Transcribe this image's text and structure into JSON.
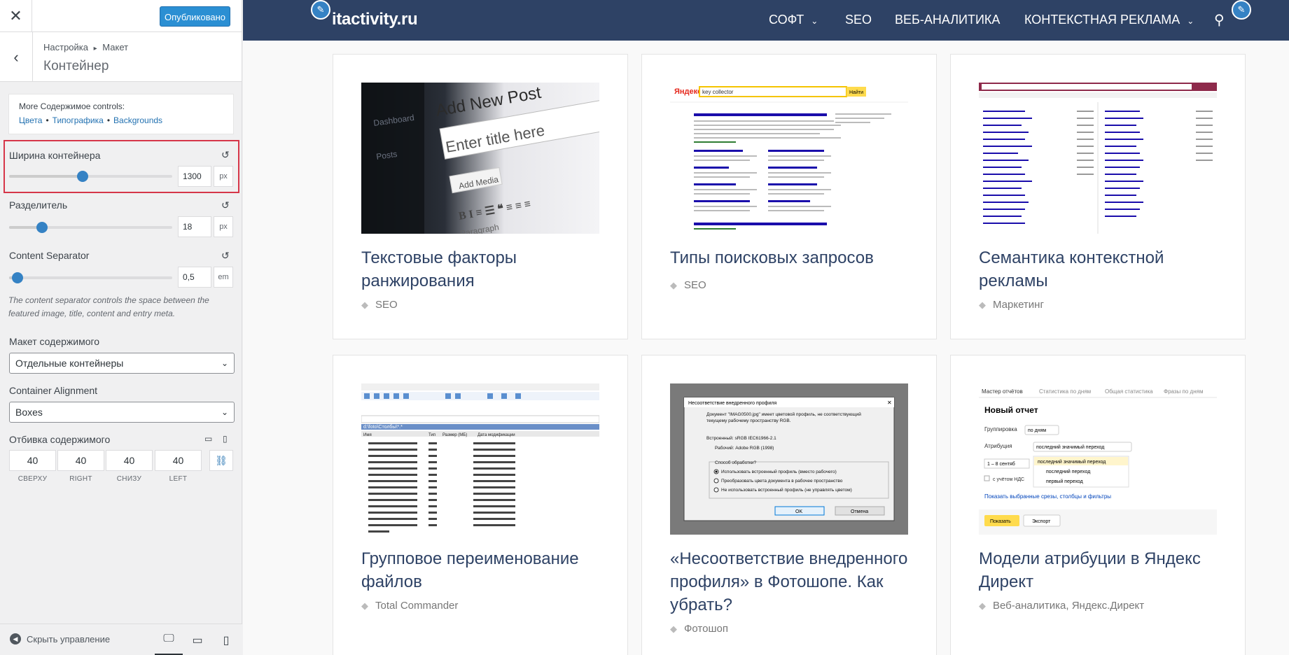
{
  "customizer": {
    "close_icon": "close-icon",
    "publish_label": "Опубликовано",
    "breadcrumb": [
      "Настройка",
      "Макет"
    ],
    "breadcrumb_sep": "▸",
    "section_title": "Контейнер",
    "more_controls": {
      "title": "More Содержимое controls:",
      "links": [
        "Цвета",
        "Типографика",
        "Backgrounds"
      ],
      "separator": "•"
    },
    "container_width": {
      "label": "Ширина контейнера",
      "value": "1300",
      "unit": "px",
      "fraction": 0.45
    },
    "separator": {
      "label": "Разделитель",
      "value": "18",
      "unit": "px",
      "fraction": 0.2
    },
    "content_separator": {
      "label": "Content Separator",
      "value": "0,5",
      "unit": "em",
      "fraction": 0.05
    },
    "content_separator_desc": "The content separator controls the space between the featured image, title, content and entry meta.",
    "content_layout": {
      "label": "Макет содержимого",
      "value": "Отдельные контейнеры"
    },
    "container_alignment": {
      "label": "Container Alignment",
      "value": "Boxes"
    },
    "content_padding": {
      "label": "Отбивка содержимого",
      "values": [
        "40",
        "40",
        "40",
        "40"
      ],
      "labels": [
        "СВЕРХУ",
        "RIGHT",
        "СНИЗУ",
        "LEFT"
      ]
    },
    "hide_controls_label": "Скрыть управление"
  },
  "site": {
    "logo": "itactivity.ru",
    "nav": [
      {
        "label": "СОФТ",
        "has_dropdown": true
      },
      {
        "label": "SEO",
        "has_dropdown": false
      },
      {
        "label": "ВЕБ-АНАЛИТИКА",
        "has_dropdown": false
      },
      {
        "label": "КОНТЕКСТНАЯ РЕКЛАМА",
        "has_dropdown": true
      }
    ],
    "posts": [
      {
        "title": "Текстовые факторы ранжирования",
        "tags": [
          "SEO"
        ]
      },
      {
        "title": "Типы поисковых запросов",
        "tags": [
          "SEO"
        ]
      },
      {
        "title": "Семантика контекстной рекламы",
        "tags": [
          "Маркетинг"
        ]
      },
      {
        "title": "Групповое переименование файлов",
        "tags": [
          "Total Commander"
        ]
      },
      {
        "title": "«Несоответствие внедренного профиля» в Фотошопе. Как убрать?",
        "tags": [
          "Фотошоп"
        ]
      },
      {
        "title": "Модели атрибуции в Яндекс Директ",
        "tags": [
          "Веб-аналитика",
          "Яндекс.Директ"
        ]
      }
    ],
    "thumb_texts": {
      "wp_add_post": "Add New Post",
      "wp_enter_title": "Enter title here",
      "wp_add_media": "Add Media",
      "wp_paragraph": "Paragraph",
      "wp_dashboard": "Dashboard",
      "wp_posts": "Posts",
      "yandex_logo": "Яндекс",
      "yandex_query": "key collector",
      "yandex_find": "Найти",
      "tc_dir": "d:\\foto\\Столбы\\*.*",
      "tc_col_name": "Имя",
      "tc_col_type": "Тип",
      "tc_col_size": "Размер (МБ)",
      "tc_col_date": "Дата модификации",
      "ps_dialog_title": "Несоответствие внедренного профиля",
      "ps_doc_text": "Документ \"IMAG0500.jpg\" имеет цветовой профиль, не соответствующий текущему рабочему пространству RGB.",
      "ps_embedded": "Встроенный: sRGB IEC61966-2.1",
      "ps_working": "Рабочий: Adobe RGB (1998)",
      "ps_question": "Способ обработки?",
      "ps_opt1": "Использовать встроенный профиль (вместо рабочего)",
      "ps_opt2": "Преобразовать цвета документа в рабочее пространство",
      "ps_opt3": "Не использовать встроенный профиль (не управлять цветом)",
      "ps_ok": "OK",
      "ps_cancel": "Отмена",
      "ym_tabs": [
        "Мастер отчётов",
        "Статистика по дням",
        "Общая статистика",
        "Фразы по дням"
      ],
      "ym_title": "Новый отчет",
      "ym_group": "Группировка",
      "ym_group_val": "по дням",
      "ym_attr": "Атрибуция",
      "ym_attr_val": "последний значимый переход",
      "ym_opts": [
        "последний значимый переход",
        "последний переход",
        "первый переход"
      ],
      "ym_period": "1 – 8 сентяб",
      "ym_vat": "с учётом НДС",
      "ym_link": "Показать выбранные срезы, столбцы и фильтры",
      "ym_show": "Показать",
      "ym_export": "Экспорт"
    }
  }
}
